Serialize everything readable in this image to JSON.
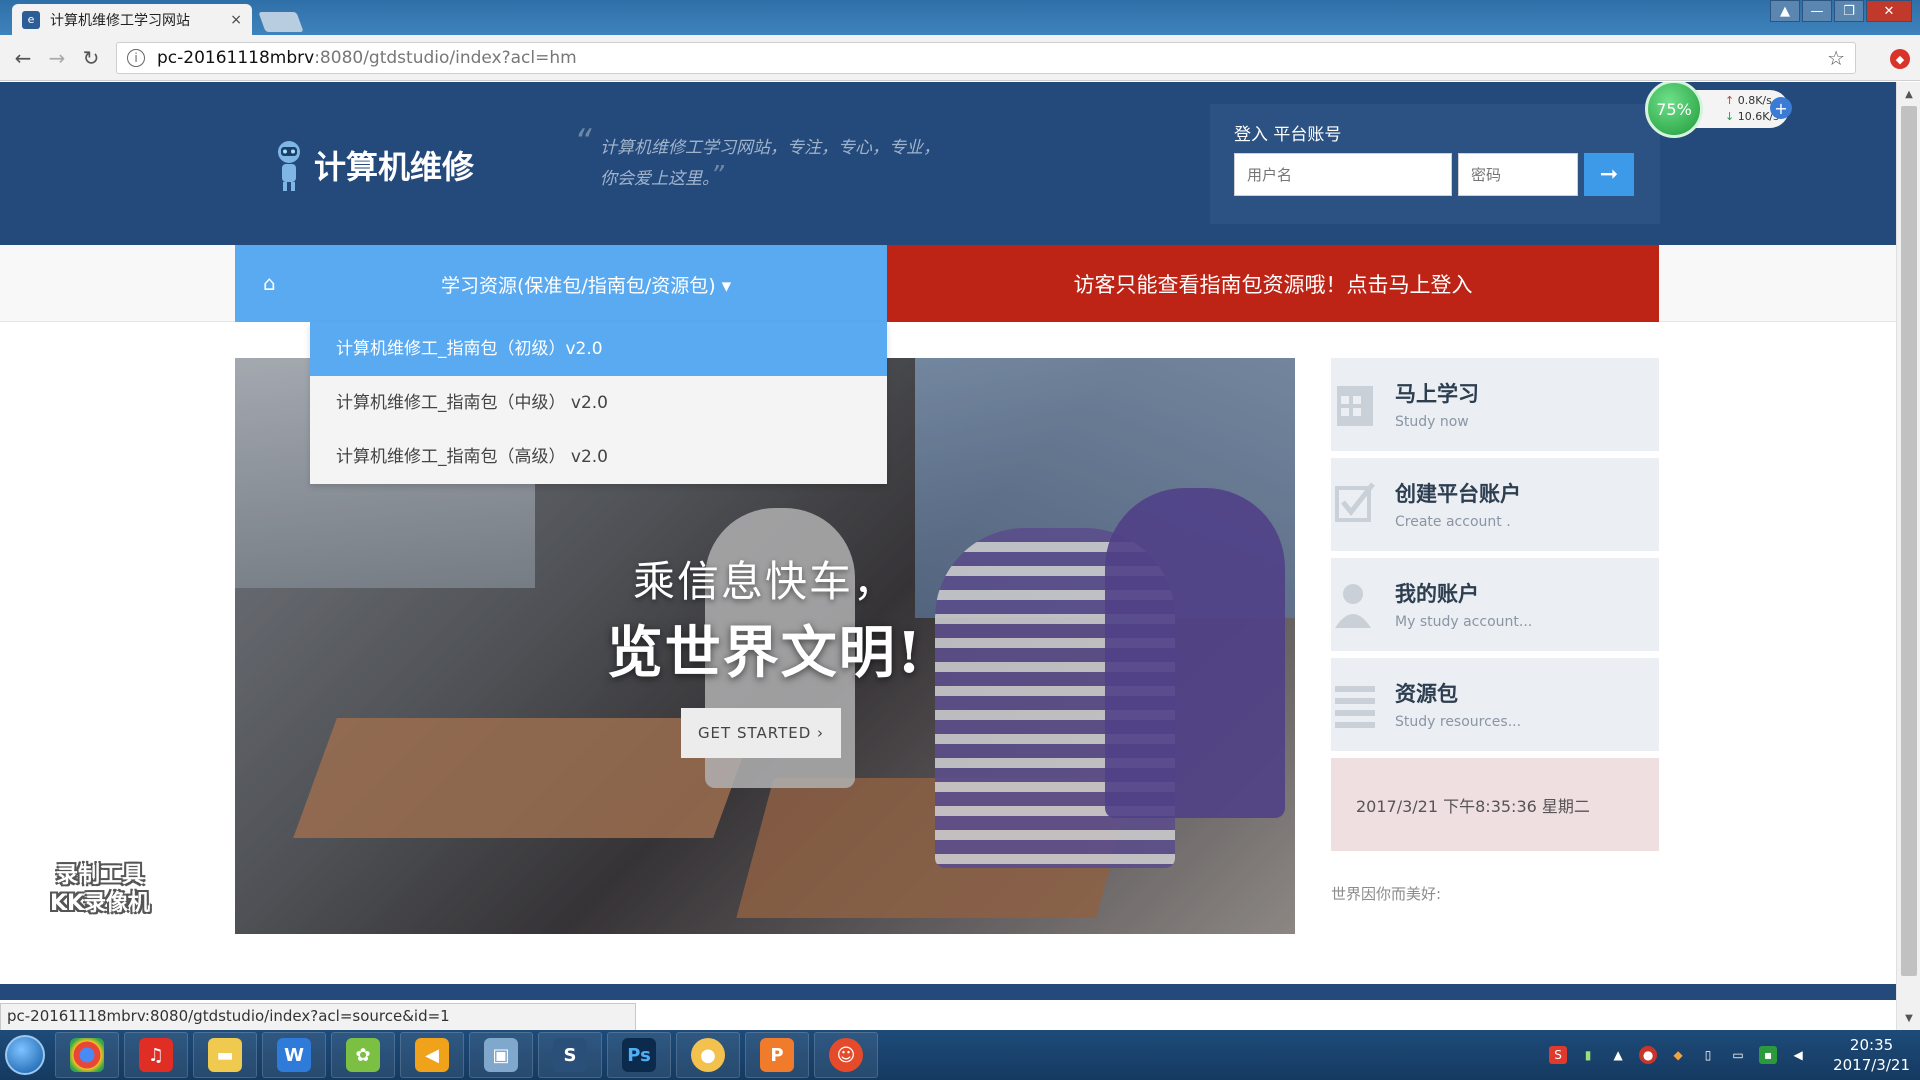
{
  "browser": {
    "tab_title": "计算机维修工学习网站",
    "tab_close": "×",
    "url_host": "pc-20161118mbrv",
    "url_path": ":8080/gtdstudio/index?acl=hm",
    "status_url": "pc-20161118mbrv:8080/gtdstudio/index?acl=source&id=1"
  },
  "header": {
    "logo_text": "计算机维修",
    "slogan_line1": "计算机维修工学习网站，专注，专心，专业，",
    "slogan_line2": "你会爱上这里。",
    "login_title": "登入 平台账号",
    "username_placeholder": "用户名",
    "password_placeholder": "密码",
    "login_arrow": "➞"
  },
  "speed_widget": {
    "percent": "75%",
    "upload": "0.8K/s",
    "download": "10.6K/s",
    "plus": "+"
  },
  "nav": {
    "home_icon": "⌂",
    "menu_label": "学习资源(保准包/指南包/资源包) ▾",
    "alert": "访客只能查看指南包资源哦！点击马上登入"
  },
  "dropdown": {
    "items": [
      "计算机维修工_指南包（初级）v2.0",
      "计算机维修工_指南包（中级） v2.0",
      "计算机维修工_指南包（高级） v2.0"
    ]
  },
  "hero": {
    "line1": "乘信息快车，",
    "line2": "览世界文明!",
    "cta": "GET STARTED ›"
  },
  "side": {
    "cards": [
      {
        "title": "马上学习",
        "subtitle": "Study now"
      },
      {
        "title": "创建平台账户",
        "subtitle": "Create account ."
      },
      {
        "title": "我的账户",
        "subtitle": "My study account..."
      },
      {
        "title": "资源包",
        "subtitle": "Study resources..."
      }
    ],
    "clock": "2017/3/21 下午8:35:36  星期二",
    "tagline": "世界因你而美好:"
  },
  "watermark": {
    "line1": "录制工具",
    "line2": "KK录像机"
  },
  "taskbar": {
    "time": "20:35",
    "date": "2017/3/21"
  },
  "colors": {
    "header_bg": "#24497b",
    "nav_blue": "#5aaaf2",
    "nav_red": "#bd2416"
  }
}
